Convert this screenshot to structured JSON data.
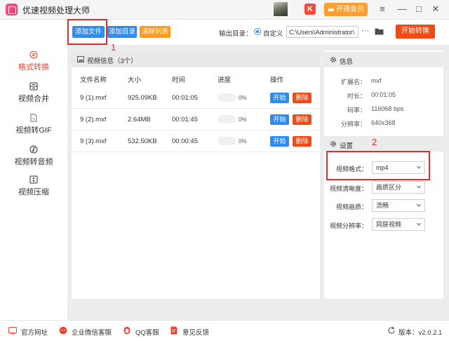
{
  "app": {
    "title": "优速视频处理大师"
  },
  "titlebar": {
    "vip_mark": "K",
    "vip_label": "开通会员",
    "menu_icon": "≡",
    "minimize_icon": "—",
    "maximize_icon": "□",
    "close_icon": "✕"
  },
  "toolbar": {
    "add_file": "添加文件",
    "add_dir": "添加目录",
    "clear_list": "清除列表",
    "output_label": "输出目录：",
    "custom_label": "自定义",
    "path_value": "C:\\Users\\Administrator\\",
    "dots": "···",
    "start_convert": "开始转换"
  },
  "sidebar": {
    "items": [
      {
        "label": "格式转换",
        "icon": "convert-icon",
        "active": true
      },
      {
        "label": "视频合并",
        "icon": "merge-icon",
        "active": false
      },
      {
        "label": "视频转GIF",
        "icon": "gif-icon",
        "active": false
      },
      {
        "label": "视频转音频",
        "icon": "audio-icon",
        "active": false
      },
      {
        "label": "视频压缩",
        "icon": "compress-icon",
        "active": false
      }
    ]
  },
  "video_panel": {
    "title": "视频信息（3个）",
    "columns": [
      "文件名称",
      "大小",
      "时间",
      "进度",
      "操作"
    ],
    "rows": [
      {
        "name": "9 (1).mxf",
        "size": "925.09KB",
        "time": "00:01:05",
        "progress": "0%",
        "start": "开始",
        "delete": "删除"
      },
      {
        "name": "9 (2).mxf",
        "size": "2.64MB",
        "time": "00:01:45",
        "progress": "0%",
        "start": "开始",
        "delete": "删除"
      },
      {
        "name": "9 (3).mxf",
        "size": "532.50KB",
        "time": "00:00:45",
        "progress": "0%",
        "start": "开始",
        "delete": "删除"
      }
    ]
  },
  "info_panel": {
    "title": "信息",
    "fields": [
      {
        "key": "扩展名：",
        "value": "mxf"
      },
      {
        "key": "时长：",
        "value": "00:01:05"
      },
      {
        "key": "码率：",
        "value": "116068 bps"
      },
      {
        "key": "分辨率：",
        "value": "640x368"
      }
    ]
  },
  "settings_panel": {
    "title": "设置",
    "fields": [
      {
        "key": "视频格式：",
        "value": "mp4"
      },
      {
        "key": "视频清晰度：",
        "value": "画质区分"
      },
      {
        "key": "视频画质：",
        "value": "流畅"
      },
      {
        "key": "视频分辨率：",
        "value": "同原视频"
      }
    ]
  },
  "annotations": {
    "one": "1",
    "two": "2"
  },
  "statusbar": {
    "website": "官方网址",
    "wechat": "企业微信客服",
    "qq": "QQ客服",
    "feedback": "意见反馈",
    "version": "版本：v2.0.2.1"
  },
  "colors": {
    "accent": "#2f8bf0",
    "danger": "#f24a15",
    "orange": "#ff9a1c",
    "annotation": "#e42b2b"
  }
}
